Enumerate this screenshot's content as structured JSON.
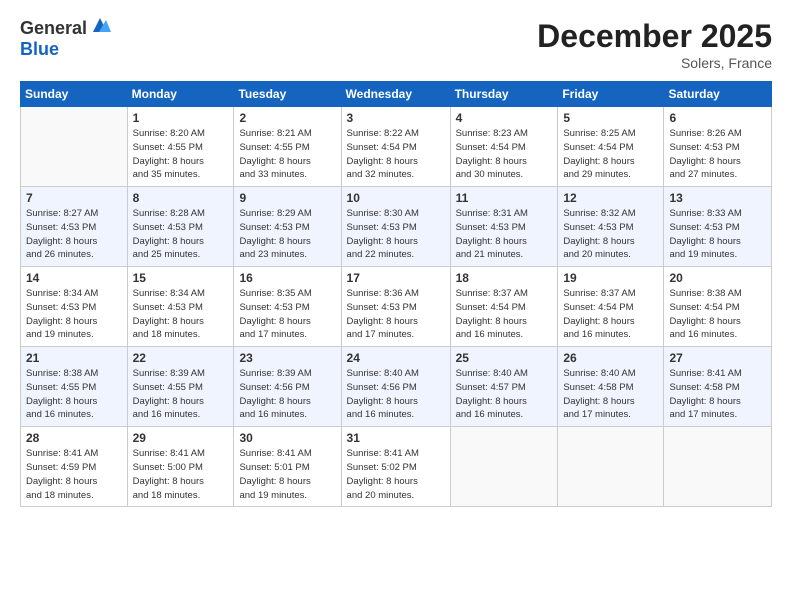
{
  "logo": {
    "line1": "General",
    "line2": "Blue"
  },
  "header": {
    "month": "December 2025",
    "location": "Solers, France"
  },
  "days_of_week": [
    "Sunday",
    "Monday",
    "Tuesday",
    "Wednesday",
    "Thursday",
    "Friday",
    "Saturday"
  ],
  "weeks": [
    [
      {
        "day": "",
        "info": ""
      },
      {
        "day": "1",
        "info": "Sunrise: 8:20 AM\nSunset: 4:55 PM\nDaylight: 8 hours\nand 35 minutes."
      },
      {
        "day": "2",
        "info": "Sunrise: 8:21 AM\nSunset: 4:55 PM\nDaylight: 8 hours\nand 33 minutes."
      },
      {
        "day": "3",
        "info": "Sunrise: 8:22 AM\nSunset: 4:54 PM\nDaylight: 8 hours\nand 32 minutes."
      },
      {
        "day": "4",
        "info": "Sunrise: 8:23 AM\nSunset: 4:54 PM\nDaylight: 8 hours\nand 30 minutes."
      },
      {
        "day": "5",
        "info": "Sunrise: 8:25 AM\nSunset: 4:54 PM\nDaylight: 8 hours\nand 29 minutes."
      },
      {
        "day": "6",
        "info": "Sunrise: 8:26 AM\nSunset: 4:53 PM\nDaylight: 8 hours\nand 27 minutes."
      }
    ],
    [
      {
        "day": "7",
        "info": "Sunrise: 8:27 AM\nSunset: 4:53 PM\nDaylight: 8 hours\nand 26 minutes."
      },
      {
        "day": "8",
        "info": "Sunrise: 8:28 AM\nSunset: 4:53 PM\nDaylight: 8 hours\nand 25 minutes."
      },
      {
        "day": "9",
        "info": "Sunrise: 8:29 AM\nSunset: 4:53 PM\nDaylight: 8 hours\nand 23 minutes."
      },
      {
        "day": "10",
        "info": "Sunrise: 8:30 AM\nSunset: 4:53 PM\nDaylight: 8 hours\nand 22 minutes."
      },
      {
        "day": "11",
        "info": "Sunrise: 8:31 AM\nSunset: 4:53 PM\nDaylight: 8 hours\nand 21 minutes."
      },
      {
        "day": "12",
        "info": "Sunrise: 8:32 AM\nSunset: 4:53 PM\nDaylight: 8 hours\nand 20 minutes."
      },
      {
        "day": "13",
        "info": "Sunrise: 8:33 AM\nSunset: 4:53 PM\nDaylight: 8 hours\nand 19 minutes."
      }
    ],
    [
      {
        "day": "14",
        "info": "Sunrise: 8:34 AM\nSunset: 4:53 PM\nDaylight: 8 hours\nand 19 minutes."
      },
      {
        "day": "15",
        "info": "Sunrise: 8:34 AM\nSunset: 4:53 PM\nDaylight: 8 hours\nand 18 minutes."
      },
      {
        "day": "16",
        "info": "Sunrise: 8:35 AM\nSunset: 4:53 PM\nDaylight: 8 hours\nand 17 minutes."
      },
      {
        "day": "17",
        "info": "Sunrise: 8:36 AM\nSunset: 4:53 PM\nDaylight: 8 hours\nand 17 minutes."
      },
      {
        "day": "18",
        "info": "Sunrise: 8:37 AM\nSunset: 4:54 PM\nDaylight: 8 hours\nand 16 minutes."
      },
      {
        "day": "19",
        "info": "Sunrise: 8:37 AM\nSunset: 4:54 PM\nDaylight: 8 hours\nand 16 minutes."
      },
      {
        "day": "20",
        "info": "Sunrise: 8:38 AM\nSunset: 4:54 PM\nDaylight: 8 hours\nand 16 minutes."
      }
    ],
    [
      {
        "day": "21",
        "info": "Sunrise: 8:38 AM\nSunset: 4:55 PM\nDaylight: 8 hours\nand 16 minutes."
      },
      {
        "day": "22",
        "info": "Sunrise: 8:39 AM\nSunset: 4:55 PM\nDaylight: 8 hours\nand 16 minutes."
      },
      {
        "day": "23",
        "info": "Sunrise: 8:39 AM\nSunset: 4:56 PM\nDaylight: 8 hours\nand 16 minutes."
      },
      {
        "day": "24",
        "info": "Sunrise: 8:40 AM\nSunset: 4:56 PM\nDaylight: 8 hours\nand 16 minutes."
      },
      {
        "day": "25",
        "info": "Sunrise: 8:40 AM\nSunset: 4:57 PM\nDaylight: 8 hours\nand 16 minutes."
      },
      {
        "day": "26",
        "info": "Sunrise: 8:40 AM\nSunset: 4:58 PM\nDaylight: 8 hours\nand 17 minutes."
      },
      {
        "day": "27",
        "info": "Sunrise: 8:41 AM\nSunset: 4:58 PM\nDaylight: 8 hours\nand 17 minutes."
      }
    ],
    [
      {
        "day": "28",
        "info": "Sunrise: 8:41 AM\nSunset: 4:59 PM\nDaylight: 8 hours\nand 18 minutes."
      },
      {
        "day": "29",
        "info": "Sunrise: 8:41 AM\nSunset: 5:00 PM\nDaylight: 8 hours\nand 18 minutes."
      },
      {
        "day": "30",
        "info": "Sunrise: 8:41 AM\nSunset: 5:01 PM\nDaylight: 8 hours\nand 19 minutes."
      },
      {
        "day": "31",
        "info": "Sunrise: 8:41 AM\nSunset: 5:02 PM\nDaylight: 8 hours\nand 20 minutes."
      },
      {
        "day": "",
        "info": ""
      },
      {
        "day": "",
        "info": ""
      },
      {
        "day": "",
        "info": ""
      }
    ]
  ]
}
